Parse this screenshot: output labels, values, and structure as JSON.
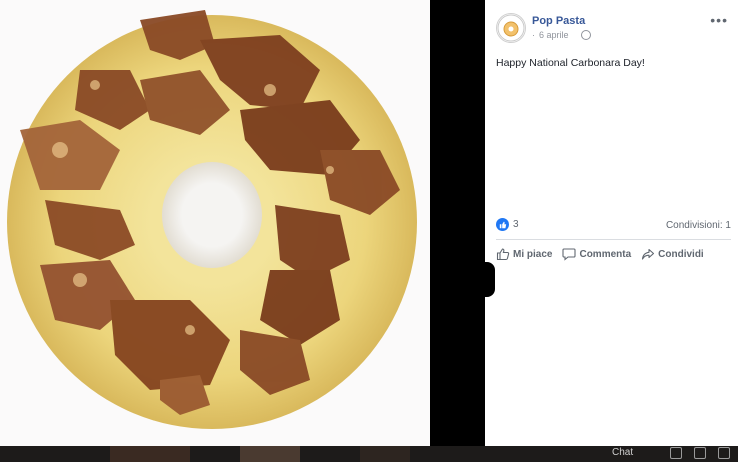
{
  "post": {
    "page_name": "Pop Pasta",
    "date": "6 aprile",
    "separator": "·",
    "text": "Happy National Carbonara Day!",
    "reaction_count": "3",
    "shares": "Condivisioni: 1",
    "actions": {
      "like": "Mi piace",
      "comment": "Commenta",
      "share": "Condividi"
    },
    "avatar_text": "POP PASTA"
  },
  "bottom_bar": {
    "chat_label": "Chat"
  },
  "colors": {
    "link": "#385898",
    "accent": "#2078f4",
    "secondary_text": "#606770"
  },
  "icons": [
    "more-options-icon",
    "globe-icon",
    "like-reaction-icon",
    "thumbs-up-icon",
    "comment-icon",
    "share-icon"
  ]
}
